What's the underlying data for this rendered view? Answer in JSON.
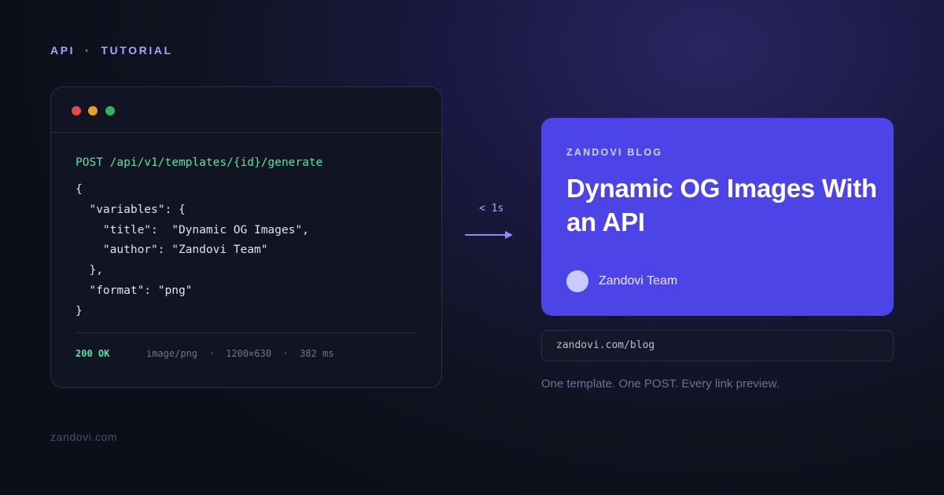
{
  "eyebrow": "API  ·  TUTORIAL",
  "terminal": {
    "endpoint": "POST /api/v1/templates/{id}/generate",
    "code": "{\n  \"variables\": {\n    \"title\":  \"Dynamic OG Images\",\n    \"author\": \"Zandovi Team\"\n  },\n  \"format\": \"png\"\n}",
    "status": "200 OK",
    "meta": "image/png  ·  1200×630  ·  382 ms"
  },
  "latency": "< 1s",
  "og_card": {
    "label": "ZANDOVI BLOG",
    "title": "Dynamic OG Images With an API",
    "author": "Zandovi Team"
  },
  "url": "zandovi.com/blog",
  "tagline": "One template. One POST. Every link preview.",
  "footer": "zandovi.com",
  "colors": {
    "accent": "#4c44e6",
    "success": "#5ee0a3",
    "traffic_red": "#e5484d",
    "traffic_yellow": "#e5a21d",
    "traffic_green": "#2fb55d"
  }
}
